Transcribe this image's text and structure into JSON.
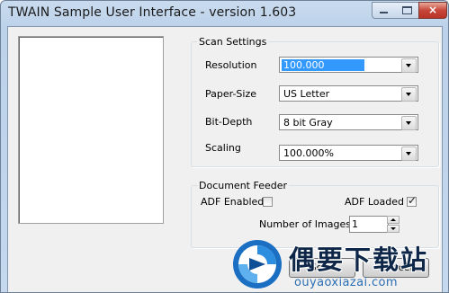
{
  "window": {
    "title": "TWAIN Sample User Interface - version 1.603",
    "close_glyph": "×"
  },
  "scan_settings": {
    "legend": "Scan Settings",
    "resolution": {
      "label": "Resolution",
      "value": "100.000"
    },
    "paper_size": {
      "label": "Paper-Size",
      "value": "US Letter"
    },
    "bit_depth": {
      "label": "Bit-Depth",
      "value": "8 bit Gray"
    },
    "scaling": {
      "label": "Scaling",
      "value": "100.000%"
    }
  },
  "document_feeder": {
    "legend": "Document Feeder",
    "adf_enabled": {
      "label": "ADF Enabled",
      "checked": false
    },
    "adf_loaded": {
      "label": "ADF Loaded",
      "checked": true,
      "mark": "✓"
    },
    "num_images": {
      "label": "Number of Images:",
      "value": "1"
    }
  },
  "buttons": {
    "scan": "Scan",
    "cancel": "Cancel"
  },
  "watermark": {
    "brand": "偶要下载站",
    "url": "ouyaoxiazai.com"
  },
  "colors": {
    "selection": "#3399ff",
    "watermark_text": "#0e2748",
    "watermark_url": "#2b6fb3"
  }
}
